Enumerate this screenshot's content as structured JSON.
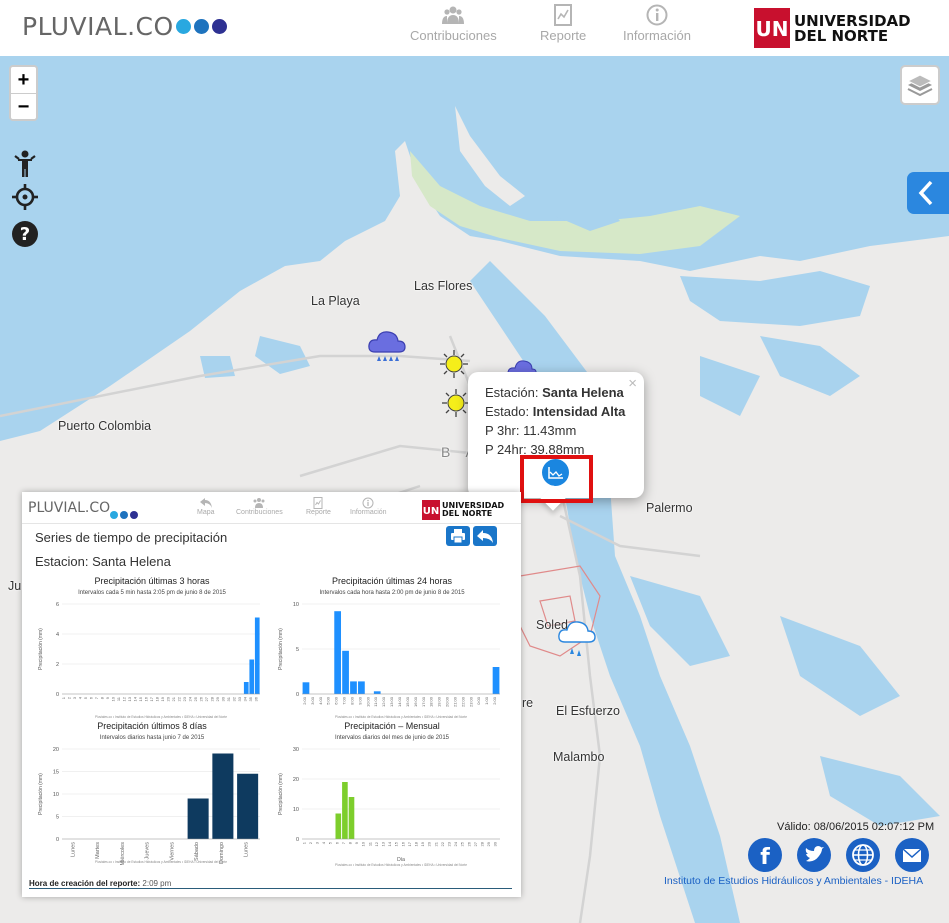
{
  "header": {
    "logo": "PLUVIAL.CO",
    "logo_dots": [
      "#29a8e0",
      "#1e73be",
      "#2e3192"
    ],
    "nav": [
      {
        "label": "Contribuciones",
        "icon": "users-icon"
      },
      {
        "label": "Reporte",
        "icon": "report-icon"
      },
      {
        "label": "Información",
        "icon": "info-icon"
      }
    ],
    "university": {
      "mark": "UN",
      "line1": "UNIVERSIDAD",
      "line2": "DEL NORTE",
      "color": "#c8102e"
    }
  },
  "map": {
    "zoom_in": "+",
    "zoom_out": "−",
    "places": {
      "la_playa": "La Playa",
      "las_flores": "Las Flores",
      "puerto_colombia": "Puerto Colombia",
      "barranquilla": "B A",
      "palermo": "Palermo",
      "soledad": "Soled",
      "el_esfuerzo": "El Esfuerzo",
      "malambo": "Malambo",
      "ju": "Ju",
      "re": "re"
    },
    "popup": {
      "station_label": "Estación:",
      "station_value": "Santa Helena",
      "state_label": "Estado:",
      "state_value": "Intensidad Alta",
      "p3_label": "P 3hr:",
      "p3_value": "11.43mm",
      "p24_label": "P 24hr:",
      "p24_value": "39.88mm",
      "close": "×"
    },
    "footer": {
      "valid": "Válido: 08/06/2015 02:07:12 PM",
      "institute": "Instituto de Estudios Hidráulicos y Ambientales - IDEHA",
      "social": [
        "facebook-icon",
        "twitter-icon",
        "globe-icon",
        "mail-icon"
      ]
    }
  },
  "report": {
    "logo": "PLUVIAL.CO",
    "nav": [
      "Mapa",
      "Contribuciones",
      "Reporte",
      "Información"
    ],
    "university": {
      "line1": "UNIVERSIDAD",
      "line2": "DEL NORTE"
    },
    "title": "Series de tiempo de precipitación",
    "station": "Estacion: Santa Helena",
    "footer_label": "Hora de creación del reporte:",
    "footer_value": "2:09 pm",
    "chart_footer": "Pluviales.co • Instituto de Estudios Hidráulicos y Ambientales • IDEHA • Universidad del Norte"
  },
  "chart_data": [
    {
      "type": "bar",
      "title": "Precipitación últimas 3 horas",
      "subtitle": "Intervalos cada 5 min hasta 2:05 pm de junio 8 de 2015",
      "ylabel": "Precipitación (mm)",
      "ylim": [
        0,
        6
      ],
      "yticks": [
        0,
        2,
        4,
        6
      ],
      "color": "#1e90ff",
      "values": [
        0,
        0,
        0,
        0,
        0,
        0,
        0,
        0,
        0,
        0,
        0,
        0,
        0,
        0,
        0,
        0,
        0,
        0,
        0,
        0,
        0,
        0,
        0,
        0,
        0,
        0,
        0,
        0,
        0,
        0,
        0,
        0,
        0,
        0.8,
        2.3,
        5.1
      ]
    },
    {
      "type": "bar",
      "title": "Precipitación últimas 24 horas",
      "subtitle": "Intervalos cada hora hasta 2:00 pm de junio 8 de 2015",
      "ylabel": "Precipitación (mm)",
      "ylim": [
        0,
        10
      ],
      "yticks": [
        0,
        5,
        10
      ],
      "color": "#1e90ff",
      "categories": [
        "2:00",
        "3:00",
        "4:00",
        "5:00",
        "6:00",
        "7:00",
        "8:00",
        "9:00",
        "10:00",
        "11:00",
        "12:00",
        "13:00",
        "14:00",
        "15:00",
        "16:00",
        "17:00",
        "18:00",
        "19:00",
        "20:00",
        "21:00",
        "22:00",
        "23:00",
        "0:00",
        "1:00",
        "2:00"
      ],
      "values": [
        1.3,
        0,
        0,
        0,
        9.2,
        4.8,
        1.4,
        1.4,
        0,
        0.3,
        0,
        0,
        0,
        0,
        0,
        0,
        0,
        0,
        0,
        0,
        0,
        0,
        0,
        0,
        3.0
      ]
    },
    {
      "type": "bar",
      "title": "Precipitación últimos 8 días",
      "subtitle": "Intervalos diarios hasta junio 7 de 2015",
      "ylabel": "Precipitación (mm)",
      "ylim": [
        0,
        20
      ],
      "yticks": [
        0,
        5,
        10,
        15,
        20
      ],
      "color": "#0e3a5f",
      "categories": [
        "Lunes",
        "Martes",
        "Miércoles",
        "Jueves",
        "Viernes",
        "Sábado",
        "Domingo",
        "Lunes"
      ],
      "values": [
        0,
        0,
        0,
        0,
        0,
        9,
        19,
        14.5
      ]
    },
    {
      "type": "bar",
      "title": "Precipitación – Mensual",
      "subtitle": "Intervalos diarios del mes de junio de 2015",
      "ylabel": "Precipitación (mm)",
      "xlabel": "Día",
      "ylim": [
        0,
        30
      ],
      "yticks": [
        0,
        10,
        20,
        30
      ],
      "color": "#7dce2c",
      "values": [
        0,
        0,
        0,
        0,
        0,
        8.5,
        19,
        14,
        0,
        0,
        0,
        0,
        0,
        0,
        0,
        0,
        0,
        0,
        0,
        0,
        0,
        0,
        0,
        0,
        0,
        0,
        0,
        0,
        0,
        0
      ]
    }
  ]
}
